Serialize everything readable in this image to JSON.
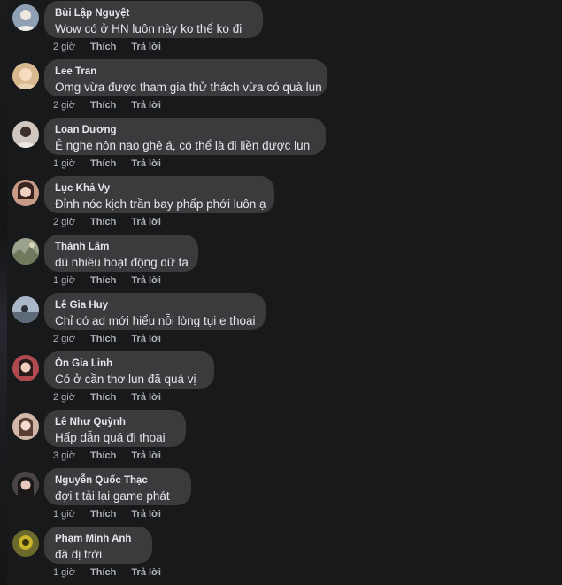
{
  "comments": [
    {
      "author": "Bùi Lập Nguyệt",
      "text": "Wow có ở HN luôn này ko thể ko đi",
      "time": "2 giờ",
      "like_label": "Thích",
      "reply_label": "Trả lời",
      "avatar_color": "#8fa0b5"
    },
    {
      "author": "Lee Tran",
      "text": "Omg vừa được tham gia thử thách vừa có quà lun",
      "time": "2 giờ",
      "like_label": "Thích",
      "reply_label": "Trả lời",
      "avatar_color": "#d8b98f"
    },
    {
      "author": "Loan Dương",
      "text": "Ê nghe nôn nao ghê á, có thể là đi liền được lun",
      "time": "1 giờ",
      "like_label": "Thích",
      "reply_label": "Trả lời",
      "avatar_color": "#cfc6c0"
    },
    {
      "author": "Lục Khả Vy",
      "text": "Đỉnh nóc kịch trần bay phấp phới luôn ạ",
      "time": "2 giờ",
      "like_label": "Thích",
      "reply_label": "Trả lời",
      "avatar_color": "#c99a86"
    },
    {
      "author": "Thành Lâm",
      "text": "dù nhiều hoạt động dữ ta",
      "time": "1 giờ",
      "like_label": "Thích",
      "reply_label": "Trả lời",
      "avatar_color": "#9aa28d"
    },
    {
      "author": "Lê Gia Huy",
      "text": "Chỉ có ad mới hiểu nỗi lòng tụi e thoai",
      "time": "2 giờ",
      "like_label": "Thích",
      "reply_label": "Trả lời",
      "avatar_color": "#a9b7c8"
    },
    {
      "author": "Ôn Gia Linh",
      "text": "Có ở cần thơ lun đã quá vị",
      "time": "2 giờ",
      "like_label": "Thích",
      "reply_label": "Trả lời",
      "avatar_color": "#b04a4f"
    },
    {
      "author": "Lê Như Quỳnh",
      "text": "Hấp dẫn quá đi thoai",
      "time": "3 giờ",
      "like_label": "Thích",
      "reply_label": "Trả lời",
      "avatar_color": "#d2b7a8"
    },
    {
      "author": "Nguyễn Quốc Thạc",
      "text": "đợi t tải lại game phát",
      "time": "1 giờ",
      "like_label": "Thích",
      "reply_label": "Trả lời",
      "avatar_color": "#4a4348"
    },
    {
      "author": "Phạm Minh Anh",
      "text": "đã dị trời",
      "time": "1 giờ",
      "like_label": "Thích",
      "reply_label": "Trả lời",
      "avatar_color": "#6b6a2c"
    }
  ]
}
